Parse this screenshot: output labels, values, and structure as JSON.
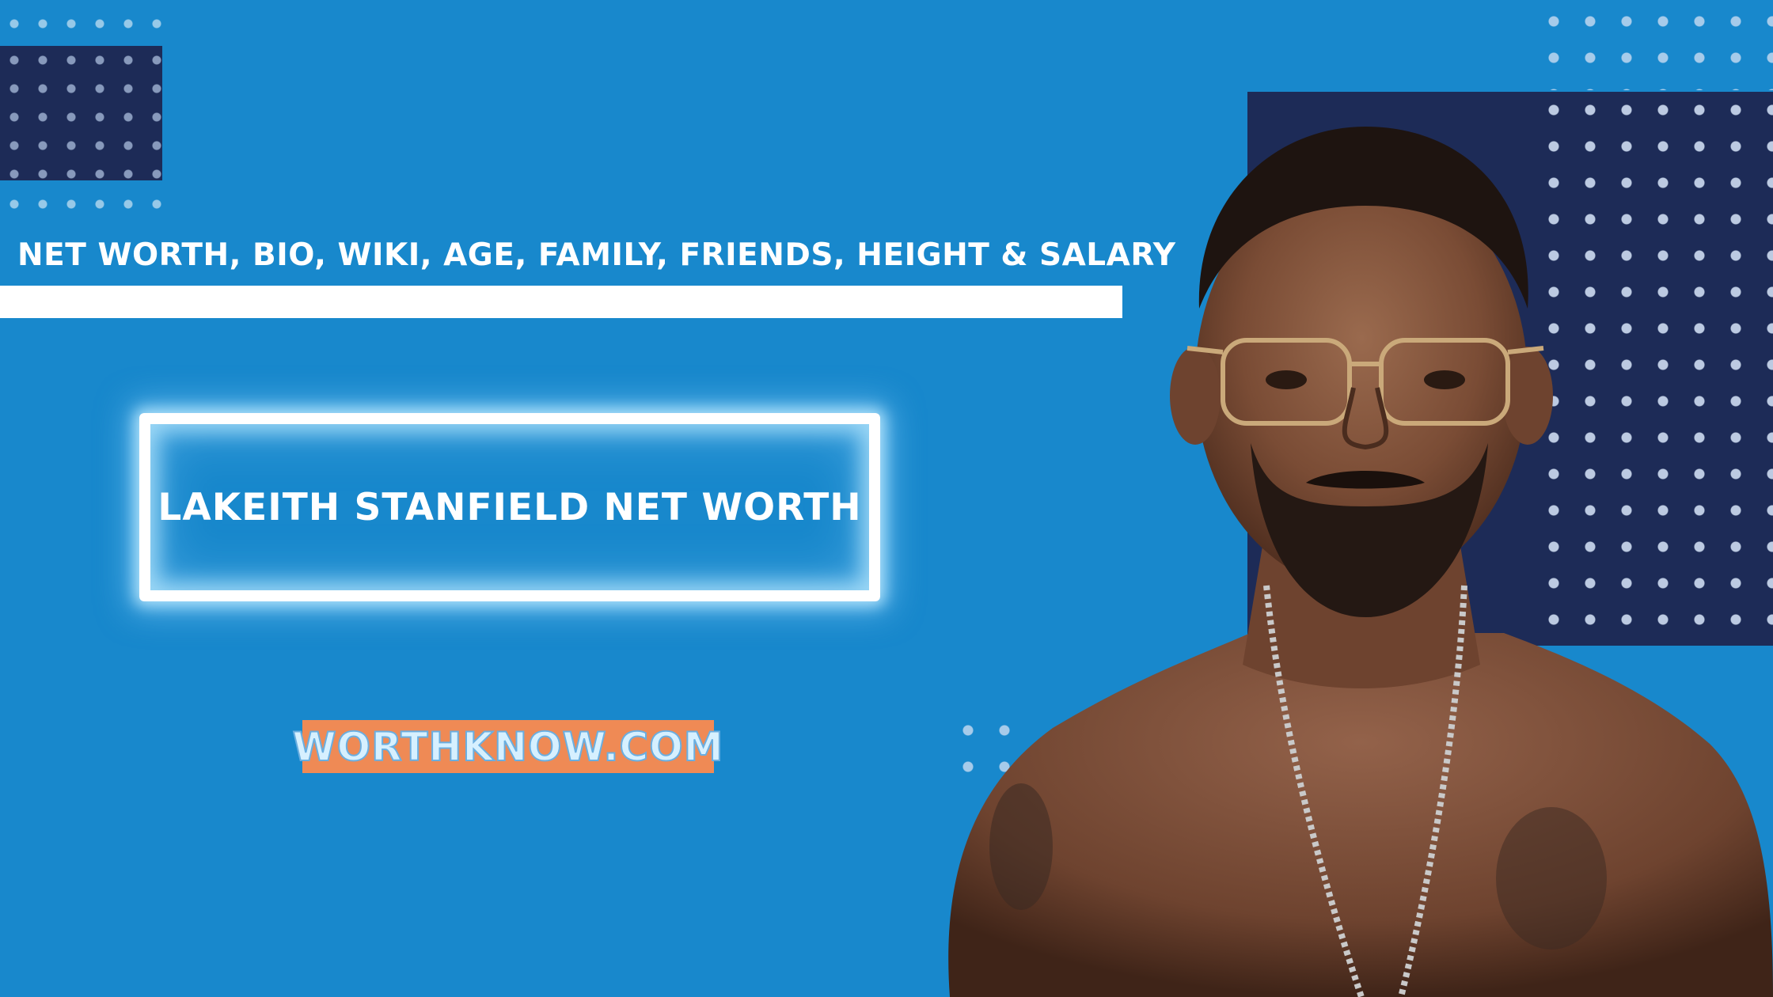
{
  "header": {
    "subtitle": "NET WORTH, BIO, WIKI, AGE, FAMILY, FRIENDS, HEIGHT & SALARY"
  },
  "main": {
    "title": "LAKEITH STANFIELD NET WORTH"
  },
  "badge": {
    "site": "WORTHKNOW.COM"
  },
  "colors": {
    "background": "#1888cc",
    "navy": "#1d2b57",
    "badge": "#ef8a55",
    "text": "#ffffff"
  },
  "icons": {
    "portrait": "person-portrait"
  }
}
